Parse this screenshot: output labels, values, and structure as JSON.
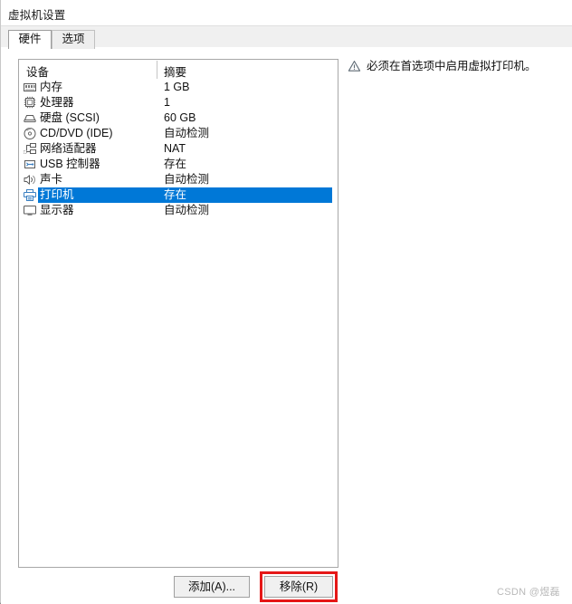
{
  "window": {
    "title": "虚拟机设置"
  },
  "tabs": [
    {
      "label": "硬件",
      "active": true
    },
    {
      "label": "选项",
      "active": false
    }
  ],
  "device_list": {
    "columns": [
      "设备",
      "摘要"
    ],
    "rows": [
      {
        "icon": "memory-icon",
        "device": "内存",
        "summary": "1 GB",
        "selected": false
      },
      {
        "icon": "processor-icon",
        "device": "处理器",
        "summary": "1",
        "selected": false
      },
      {
        "icon": "harddisk-icon",
        "device": "硬盘 (SCSI)",
        "summary": "60 GB",
        "selected": false
      },
      {
        "icon": "cd-dvd-icon",
        "device": "CD/DVD (IDE)",
        "summary": "自动检测",
        "selected": false
      },
      {
        "icon": "network-adapter-icon",
        "device": "网络适配器",
        "summary": "NAT",
        "selected": false
      },
      {
        "icon": "usb-controller-icon",
        "device": "USB 控制器",
        "summary": "存在",
        "selected": false
      },
      {
        "icon": "sound-card-icon",
        "device": "声卡",
        "summary": "自动检测",
        "selected": false
      },
      {
        "icon": "printer-icon",
        "device": "打印机",
        "summary": "存在",
        "selected": true
      },
      {
        "icon": "display-icon",
        "device": "显示器",
        "summary": "自动检测",
        "selected": false
      }
    ]
  },
  "info_panel": {
    "warning_icon": "warning-triangle-icon",
    "warning_text": "必须在首选项中启用虚拟打印机。"
  },
  "buttons": {
    "add_label": "添加(A)...",
    "remove_label": "移除(R)"
  },
  "annotation": {
    "highlight_color": "#e51717",
    "target": "remove-button"
  },
  "watermark": {
    "text": "CSDN @煜磊"
  },
  "colors": {
    "selection": "#0078d7",
    "tab_strip": "#f0f0f0",
    "button_face": "#f0f0f0",
    "list_border": "#a7a7a7"
  }
}
